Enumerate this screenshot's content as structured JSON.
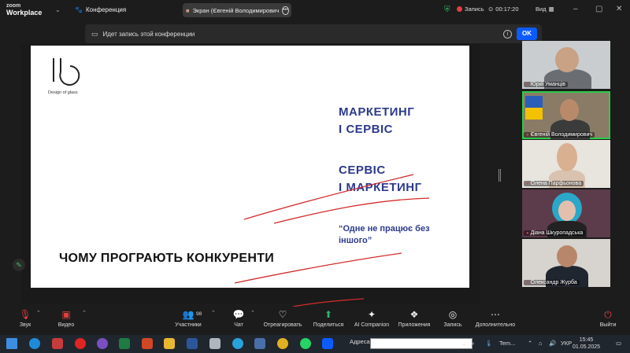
{
  "titlebar": {
    "logo_line1": "zoom",
    "logo_line2": "Workplace",
    "conference_label": "Конференция",
    "screen_share_label": "Экран (Євгеній Володимирович",
    "recording_label": "Запись",
    "timer": "00:17:20",
    "view_label": "Вид"
  },
  "banner": {
    "message": "Идет запись этой конференции",
    "ok_label": "OK"
  },
  "slide": {
    "logo_text": "Design of glass",
    "heading1_line1": "МАРКЕТИНГ",
    "heading1_line2": "І СЕРВІС",
    "heading2_line1": "СЕРВІС",
    "heading2_line2": "І МАРКЕТИНГ",
    "quote_line1": "“Одне не працює без",
    "quote_line2": "іншого”",
    "bottom_title": "ЧОМУ ПРОГРАЮТЬ КОНКУРЕНТИ"
  },
  "participants": [
    {
      "name": "Юрій Уманців",
      "active": false
    },
    {
      "name": "Євгеній Володимирович",
      "active": true
    },
    {
      "name": "Олена Парфьонова",
      "active": false
    },
    {
      "name": "Діана Шкуропадська",
      "active": false
    },
    {
      "name": "Олександр Журба",
      "active": false
    }
  ],
  "toolbar": {
    "audio": "Звук",
    "video": "Видео",
    "participants": "Участники",
    "participants_count": "98",
    "chat": "Чат",
    "react": "Отреагировать",
    "share": "Поделиться",
    "ai": "AI Companion",
    "apps": "Приложения",
    "record": "Запись",
    "more": "Дополнительно",
    "leave": "Выйти"
  },
  "taskbar": {
    "address_label": "Адреса",
    "weather": "Tem...",
    "language": "УКР",
    "time": "15:45",
    "date": "01.05.2025"
  },
  "colors": {
    "zoom_blue": "#0b5cff",
    "slide_text_blue": "#2c3a8c",
    "annotation_red": "#d22b2b",
    "active_speaker_green": "#2ccc4a"
  }
}
